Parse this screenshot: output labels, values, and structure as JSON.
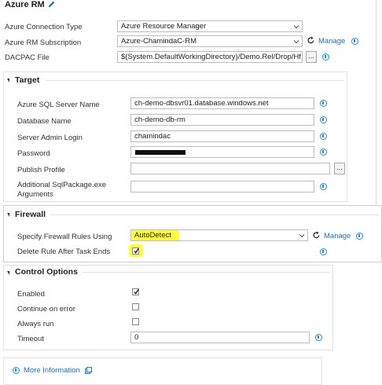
{
  "title": "Azure RM",
  "top": {
    "connection_type": {
      "label": "Azure Connection Type",
      "value": "Azure Resource Manager"
    },
    "subscription": {
      "label": "Azure RM Subscription",
      "value": "Azure-ChamindaC-RM",
      "manage": "Manage"
    },
    "dacpac": {
      "label": "DACPAC File",
      "value": "$(System.DefaultWorkingDirectory)/Demo.Rel/Drop/Hf",
      "browse": "..."
    }
  },
  "target": {
    "title": "Target",
    "server": {
      "label": "Azure SQL Server Name",
      "value": "ch-demo-dbsvr01.database.windows.net"
    },
    "database": {
      "label": "Database Name",
      "value": "ch-demo-db-rm"
    },
    "login": {
      "label": "Server Admin Login",
      "value": "chamindac"
    },
    "password": {
      "label": "Password"
    },
    "publish_profile": {
      "label": "Publish Profile",
      "value": "",
      "browse": "..."
    },
    "sqlpackage_args": {
      "label_line1": "Additional SqlPackage.exe",
      "label_line2": "Arguments",
      "value": ""
    }
  },
  "firewall": {
    "title": "Firewall",
    "rules": {
      "label": "Specify Firewall Rules Using",
      "value": "AutoDetect",
      "manage": "Manage"
    },
    "delete_rule": {
      "label": "Delete Rule After Task Ends",
      "checked": true
    }
  },
  "control": {
    "title": "Control Options",
    "enabled": {
      "label": "Enabled",
      "checked": true
    },
    "continue_on_error": {
      "label": "Continue on error",
      "checked": false
    },
    "always_run": {
      "label": "Always run",
      "checked": false
    },
    "timeout": {
      "label": "Timeout",
      "value": "0"
    }
  },
  "more_info": {
    "label": "More Information"
  },
  "colors": {
    "accent": "#1e8fd6",
    "link": "#1e6fb5",
    "highlight": "#ffff3d"
  }
}
